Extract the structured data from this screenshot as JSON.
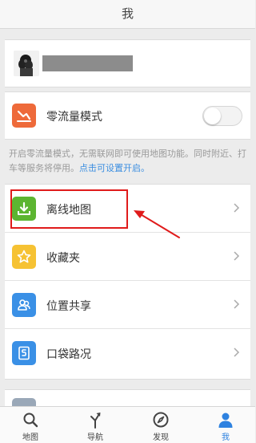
{
  "header": {
    "title": "我"
  },
  "profile": {
    "avatar_icon": "user-avatar-icon"
  },
  "zero_traffic": {
    "label": "零流量模式",
    "toggle_on": false,
    "icon": "zero-traffic-icon",
    "icon_color": "#ee6a3a"
  },
  "description": {
    "text": "开启零流量模式，无需联网即可使用地图功能。同时附近、打车等服务将停用。",
    "link": "点击可设置开启。"
  },
  "menu": {
    "items": [
      {
        "label": "离线地图",
        "icon": "download-icon",
        "color": "#5cb531"
      },
      {
        "label": "收藏夹",
        "icon": "star-icon",
        "color": "#f6c233"
      },
      {
        "label": "位置共享",
        "icon": "share-location-icon",
        "color": "#3a90e6"
      },
      {
        "label": "口袋路况",
        "icon": "traffic-icon",
        "color": "#3a90e6"
      }
    ]
  },
  "tabbar": {
    "items": [
      {
        "label": "地图",
        "icon": "search-icon"
      },
      {
        "label": "导航",
        "icon": "navigation-icon"
      },
      {
        "label": "发现",
        "icon": "compass-icon"
      },
      {
        "label": "我",
        "icon": "person-icon",
        "active": true
      }
    ],
    "active_color": "#2e82e0"
  },
  "annotation": {
    "highlight_color": "#e01b1b"
  }
}
